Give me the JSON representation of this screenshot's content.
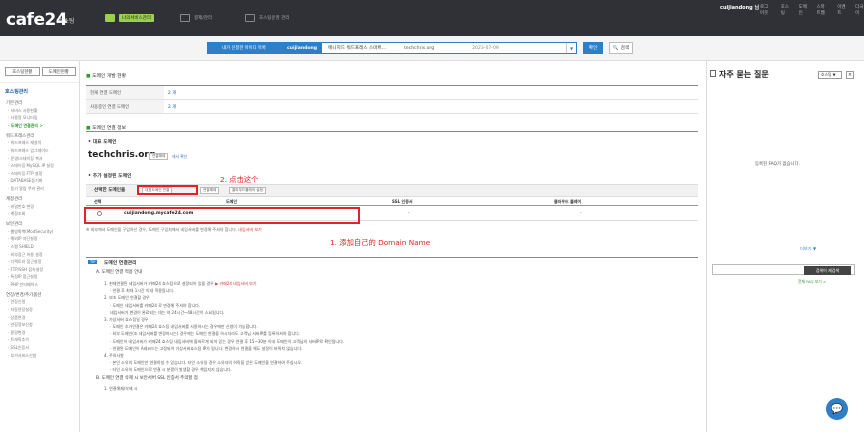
{
  "brand": {
    "logo": "cafe24",
    "sub": "호스팅"
  },
  "topnav": {
    "tabs": [
      "나의서비스관리",
      "결제/관리",
      "호스팅운영 관리"
    ]
  },
  "topbar": {
    "user": "cuijiandong 님",
    "links": [
      "로그아웃",
      "호스팅",
      "도메인",
      "스마트웹",
      "이벤트",
      "다국어"
    ]
  },
  "selector": {
    "label": "내가 신청한 아이디 목록",
    "user": "cuijiandong",
    "product": "매니지드 워드프레스 스마트...",
    "domain": "techchris.org",
    "date": "2023-07-09",
    "arrow": "▼",
    "confirm": "확인",
    "search": "검색",
    "search_icon": "🔍"
  },
  "leftnav": {
    "tabs": [
      "호스팅현황",
      "도메인현황"
    ],
    "sections": [
      {
        "title": "호스팅관리",
        "groups": [
          {
            "name": "기본관리",
            "items": [
              "서비스 사용현황",
              "사용량 모니터링",
              "도메인 연결관리 >"
            ],
            "active": 2
          },
          {
            "name": "워드프레스관리",
            "items": [
              "워드프레스 재설치",
              "워드프레스 업그레이드",
              "운영/스테이징 복사",
              "스테이징 MySQL IP 설정",
              "스테이징 FTP 설정",
              "DATABASE동기화",
              "동기 알림 쿠키 관리"
            ]
          },
          {
            "name": "계정관리",
            "items": [
              "비밀번호 변경",
              "계정조회"
            ]
          },
          {
            "name": "보안관리",
            "items": [
              "웹방화벽(ModSecurity)",
              "해외IP 차단설정",
              "스팸 SHIELD",
              "외부접근 허용 설정",
              "디렉토리 접근설정",
              "FTP/SSH 접속설정",
              "특정IP 접근설정",
              "PHP 인터페이스"
            ]
          },
          {
            "name": "연장/변경/추가옵션",
            "items": [
              "연장신청",
              "자동연장설정",
              "상품변경",
              "연장정보신청",
              "용량변경",
              "트래픽추가",
              "SSL인증서",
              "부가서비스신청"
            ]
          }
        ]
      }
    ]
  },
  "main": {
    "status_title": "도메인 개발 현황",
    "status_rows": [
      {
        "k": "현재 연결 도메인",
        "v": "2 개"
      },
      {
        "k": "사용중인 연결 도메인",
        "v": "2 개"
      }
    ],
    "info_title": "도메인 연결 정보",
    "rep_head": "대표 도메인",
    "rep_domain": "techchris.org",
    "rep_btn": "연결해제",
    "rep_link": "에서 확인",
    "add_head": "추가 설정된 도메인",
    "sel_label": "선택한 도메인을",
    "btn_connect": "대표도메인 연결",
    "btn_disconnect": "연결해제",
    "btn_cloudflare": "클라우드플레어 설정",
    "table_head": [
      "선택",
      "도메인",
      "SSL 인증서",
      "클라우드 플레어"
    ],
    "table_row": {
      "domain": "cuijiandong.mycafe24.com",
      "ssl": "-",
      "cf": "-"
    },
    "note": "※ 외부에서 도메인을 구입하신 경우, 도메인 구입처에서 네임서버를 변경해 주셔야 합니다.",
    "note_link": "네임서버 보기",
    "annotation_step1": "1. 添加自己的 Domain Name",
    "annotation_step2": "2. 点击这个"
  },
  "guide": {
    "badge": "TIP",
    "title": "도메인 연결관리",
    "lines": [
      {
        "t": "A. 도메인 연결 적용 안내",
        "head": true
      },
      {
        "t": "1. 현재연결된 네임서버가 카페24 호스팅으로 설정되어 있을 경우",
        "link": "▶ 카페24 네임서버 보기"
      },
      {
        "t": "· 연결 후 최대 1시간 이내 적용됩니다."
      },
      {
        "t": "2. 보조 도메인 연결할 경우"
      },
      {
        "t": "· 도메인 네임서버를 카페24 로 변경해 주셔야 합니다."
      },
      {
        "t": "네임서버가 변경이 완료되는 데는 약 24시간~48시간이 소요됩니다."
      },
      {
        "t": "3. 가상서버 호스팅일 경우"
      },
      {
        "t": "· 도메인 추가연결은 카페24 호스팅 네임서버를 사용하시는 경우에만 신청이 가능합니다."
      },
      {
        "t": "· 외부 도메인(조 네임서버를 변경하시는) 경우에는 도메인 연결을 하시더라도 고객님 서버IP를 등록하셔야 합니다."
      },
      {
        "t": "· 도메인이 네임서버가 카페24 호스팅 네임서버에 올바르게 되어 있는 경우 연결 후 15~30분 이내 도메인이 고객님의 서버IP로 확인됩니다."
      },
      {
        "t": "· 연결된 도메인이 A레코드는 고정되어 가상서버호스팅 IP가 됩니다. 변경하시 연결을 해도 설정이 바뀌지 않습니다."
      },
      {
        "t": "4. 주의사항"
      },
      {
        "t": "· 본인 소유의 도메인만 연결하실 수 있습니다. 타인 소유일 경우 소유자의 허락을 얻은 도메인을 연결하여 주십시오."
      },
      {
        "t": "· 타인 소유의 도메인으로 연결 시 분쟁이 발생할 경우 책임지지 않습니다."
      },
      {
        "t": "B. 도메인 연결 삭제 시 보안서버 SSL 인증서 주의할 점",
        "head": true
      },
      {
        "t": "1. 연결해제/삭제 시"
      }
    ]
  },
  "faq": {
    "title": "자주 묻는 질문",
    "select": "호스팅 ▼",
    "close": "×",
    "empty": "등록된 FAQ가 없습니다.",
    "more": "더보기 ▼",
    "search_btn": "검색어 재검색",
    "all": "전체 FAQ 보기 >"
  },
  "help_fab_icon": "💬"
}
